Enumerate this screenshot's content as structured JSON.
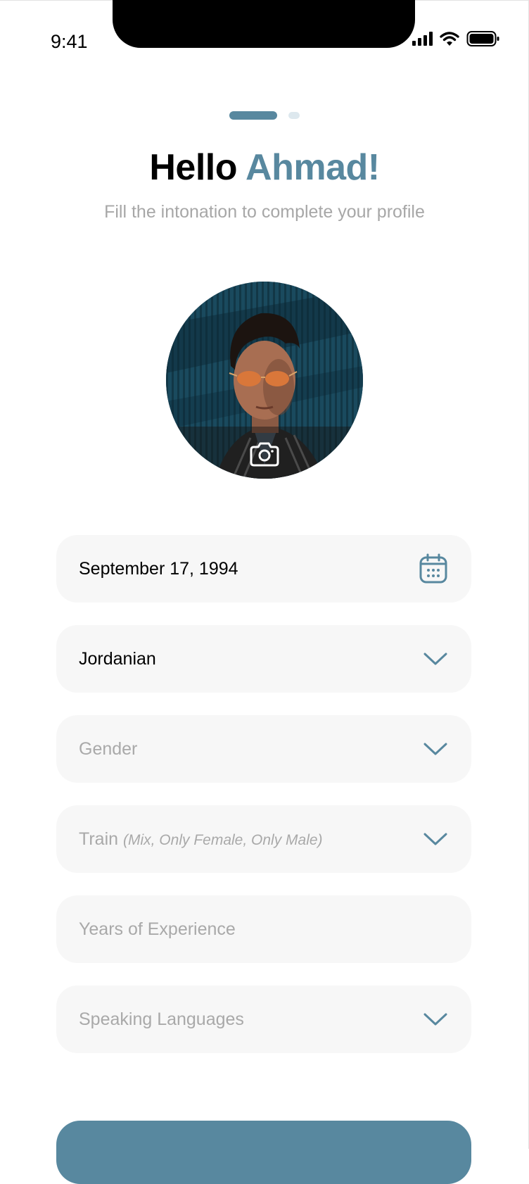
{
  "status_bar": {
    "time": "9:41"
  },
  "pager": {
    "current_page": 1,
    "total_pages": 2
  },
  "header": {
    "greeting": "Hello",
    "name": "Ahmad!",
    "subtitle": "Fill the intonation to complete your profile"
  },
  "profile_photo": {
    "icon": "camera-icon"
  },
  "form": {
    "birth_date": {
      "value": "September 17, 1994",
      "icon": "calendar-icon"
    },
    "nationality": {
      "value": "Jordanian",
      "icon": "chevron-down-icon"
    },
    "gender": {
      "placeholder": "Gender",
      "icon": "chevron-down-icon"
    },
    "train": {
      "placeholder": "Train",
      "hint": "(Mix, Only Female, Only Male)",
      "icon": "chevron-down-icon"
    },
    "experience": {
      "placeholder": "Years of Experience"
    },
    "languages": {
      "placeholder": "Speaking Languages",
      "icon": "chevron-down-icon"
    }
  },
  "colors": {
    "accent": "#58889f",
    "field_bg": "#f7f7f7",
    "placeholder_text": "#a9a9a9",
    "subtitle_text": "#a7a7a7"
  }
}
